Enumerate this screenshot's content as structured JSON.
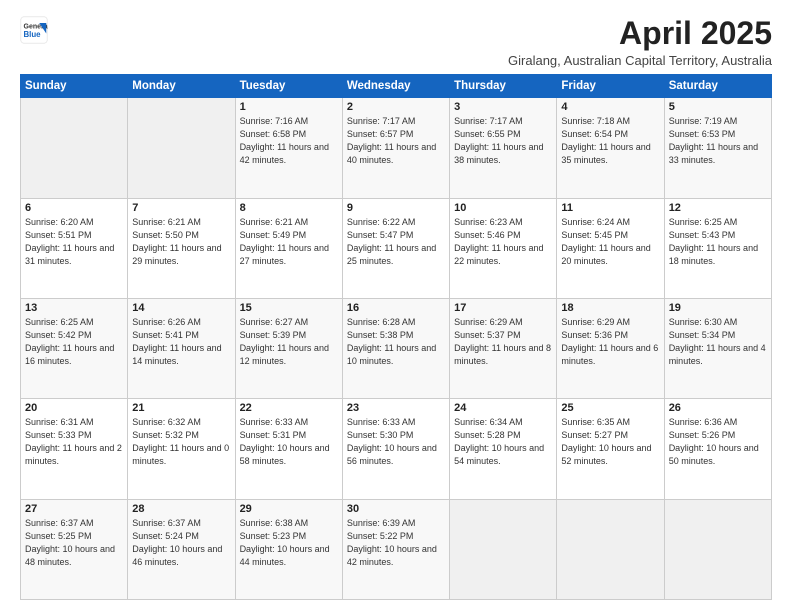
{
  "logo": {
    "line1": "General",
    "line2": "Blue"
  },
  "title": "April 2025",
  "subtitle": "Giralang, Australian Capital Territory, Australia",
  "days_of_week": [
    "Sunday",
    "Monday",
    "Tuesday",
    "Wednesday",
    "Thursday",
    "Friday",
    "Saturday"
  ],
  "weeks": [
    [
      {
        "day": "",
        "sunrise": "",
        "sunset": "",
        "daylight": ""
      },
      {
        "day": "",
        "sunrise": "",
        "sunset": "",
        "daylight": ""
      },
      {
        "day": "1",
        "sunrise": "Sunrise: 7:16 AM",
        "sunset": "Sunset: 6:58 PM",
        "daylight": "Daylight: 11 hours and 42 minutes."
      },
      {
        "day": "2",
        "sunrise": "Sunrise: 7:17 AM",
        "sunset": "Sunset: 6:57 PM",
        "daylight": "Daylight: 11 hours and 40 minutes."
      },
      {
        "day": "3",
        "sunrise": "Sunrise: 7:17 AM",
        "sunset": "Sunset: 6:55 PM",
        "daylight": "Daylight: 11 hours and 38 minutes."
      },
      {
        "day": "4",
        "sunrise": "Sunrise: 7:18 AM",
        "sunset": "Sunset: 6:54 PM",
        "daylight": "Daylight: 11 hours and 35 minutes."
      },
      {
        "day": "5",
        "sunrise": "Sunrise: 7:19 AM",
        "sunset": "Sunset: 6:53 PM",
        "daylight": "Daylight: 11 hours and 33 minutes."
      }
    ],
    [
      {
        "day": "6",
        "sunrise": "Sunrise: 6:20 AM",
        "sunset": "Sunset: 5:51 PM",
        "daylight": "Daylight: 11 hours and 31 minutes."
      },
      {
        "day": "7",
        "sunrise": "Sunrise: 6:21 AM",
        "sunset": "Sunset: 5:50 PM",
        "daylight": "Daylight: 11 hours and 29 minutes."
      },
      {
        "day": "8",
        "sunrise": "Sunrise: 6:21 AM",
        "sunset": "Sunset: 5:49 PM",
        "daylight": "Daylight: 11 hours and 27 minutes."
      },
      {
        "day": "9",
        "sunrise": "Sunrise: 6:22 AM",
        "sunset": "Sunset: 5:47 PM",
        "daylight": "Daylight: 11 hours and 25 minutes."
      },
      {
        "day": "10",
        "sunrise": "Sunrise: 6:23 AM",
        "sunset": "Sunset: 5:46 PM",
        "daylight": "Daylight: 11 hours and 22 minutes."
      },
      {
        "day": "11",
        "sunrise": "Sunrise: 6:24 AM",
        "sunset": "Sunset: 5:45 PM",
        "daylight": "Daylight: 11 hours and 20 minutes."
      },
      {
        "day": "12",
        "sunrise": "Sunrise: 6:25 AM",
        "sunset": "Sunset: 5:43 PM",
        "daylight": "Daylight: 11 hours and 18 minutes."
      }
    ],
    [
      {
        "day": "13",
        "sunrise": "Sunrise: 6:25 AM",
        "sunset": "Sunset: 5:42 PM",
        "daylight": "Daylight: 11 hours and 16 minutes."
      },
      {
        "day": "14",
        "sunrise": "Sunrise: 6:26 AM",
        "sunset": "Sunset: 5:41 PM",
        "daylight": "Daylight: 11 hours and 14 minutes."
      },
      {
        "day": "15",
        "sunrise": "Sunrise: 6:27 AM",
        "sunset": "Sunset: 5:39 PM",
        "daylight": "Daylight: 11 hours and 12 minutes."
      },
      {
        "day": "16",
        "sunrise": "Sunrise: 6:28 AM",
        "sunset": "Sunset: 5:38 PM",
        "daylight": "Daylight: 11 hours and 10 minutes."
      },
      {
        "day": "17",
        "sunrise": "Sunrise: 6:29 AM",
        "sunset": "Sunset: 5:37 PM",
        "daylight": "Daylight: 11 hours and 8 minutes."
      },
      {
        "day": "18",
        "sunrise": "Sunrise: 6:29 AM",
        "sunset": "Sunset: 5:36 PM",
        "daylight": "Daylight: 11 hours and 6 minutes."
      },
      {
        "day": "19",
        "sunrise": "Sunrise: 6:30 AM",
        "sunset": "Sunset: 5:34 PM",
        "daylight": "Daylight: 11 hours and 4 minutes."
      }
    ],
    [
      {
        "day": "20",
        "sunrise": "Sunrise: 6:31 AM",
        "sunset": "Sunset: 5:33 PM",
        "daylight": "Daylight: 11 hours and 2 minutes."
      },
      {
        "day": "21",
        "sunrise": "Sunrise: 6:32 AM",
        "sunset": "Sunset: 5:32 PM",
        "daylight": "Daylight: 11 hours and 0 minutes."
      },
      {
        "day": "22",
        "sunrise": "Sunrise: 6:33 AM",
        "sunset": "Sunset: 5:31 PM",
        "daylight": "Daylight: 10 hours and 58 minutes."
      },
      {
        "day": "23",
        "sunrise": "Sunrise: 6:33 AM",
        "sunset": "Sunset: 5:30 PM",
        "daylight": "Daylight: 10 hours and 56 minutes."
      },
      {
        "day": "24",
        "sunrise": "Sunrise: 6:34 AM",
        "sunset": "Sunset: 5:28 PM",
        "daylight": "Daylight: 10 hours and 54 minutes."
      },
      {
        "day": "25",
        "sunrise": "Sunrise: 6:35 AM",
        "sunset": "Sunset: 5:27 PM",
        "daylight": "Daylight: 10 hours and 52 minutes."
      },
      {
        "day": "26",
        "sunrise": "Sunrise: 6:36 AM",
        "sunset": "Sunset: 5:26 PM",
        "daylight": "Daylight: 10 hours and 50 minutes."
      }
    ],
    [
      {
        "day": "27",
        "sunrise": "Sunrise: 6:37 AM",
        "sunset": "Sunset: 5:25 PM",
        "daylight": "Daylight: 10 hours and 48 minutes."
      },
      {
        "day": "28",
        "sunrise": "Sunrise: 6:37 AM",
        "sunset": "Sunset: 5:24 PM",
        "daylight": "Daylight: 10 hours and 46 minutes."
      },
      {
        "day": "29",
        "sunrise": "Sunrise: 6:38 AM",
        "sunset": "Sunset: 5:23 PM",
        "daylight": "Daylight: 10 hours and 44 minutes."
      },
      {
        "day": "30",
        "sunrise": "Sunrise: 6:39 AM",
        "sunset": "Sunset: 5:22 PM",
        "daylight": "Daylight: 10 hours and 42 minutes."
      },
      {
        "day": "",
        "sunrise": "",
        "sunset": "",
        "daylight": ""
      },
      {
        "day": "",
        "sunrise": "",
        "sunset": "",
        "daylight": ""
      },
      {
        "day": "",
        "sunrise": "",
        "sunset": "",
        "daylight": ""
      }
    ]
  ]
}
